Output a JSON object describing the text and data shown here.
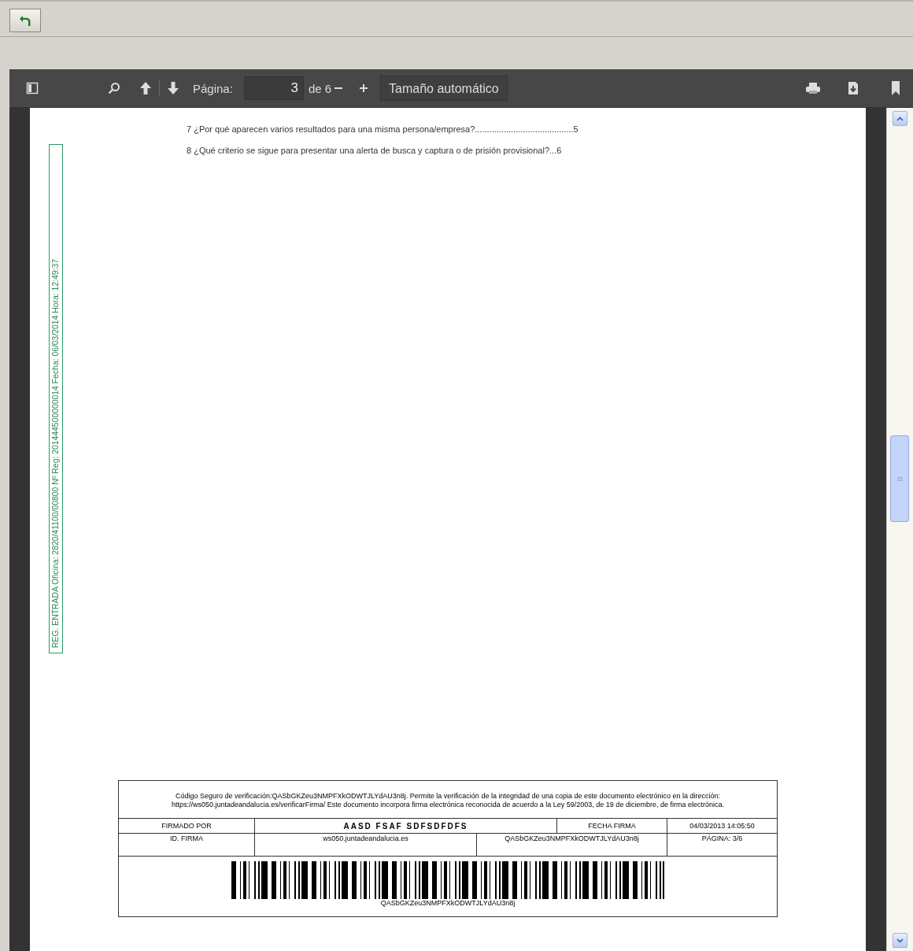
{
  "toolbar": {
    "page_label": "Página:",
    "page_number": "3",
    "page_count": "de 6",
    "zoom": "Tamaño automático"
  },
  "page": {
    "toc_lines": [
      {
        "text": "7 ¿Por qué aparecen varios resultados para una misma persona/empresa?.........................................5"
      },
      {
        "text": "8 ¿Qué criterio se sigue para presentar una alerta de busca y captura o de prisión provisional?...6"
      }
    ],
    "registry_stamp": "REG. ENTRADA Oficina: 2820/41100/00800 Nº Reg: 201444500000014 Fecha: 06/03/2014 Hora: 12:49:37",
    "signature_block": {
      "notice": "Código Seguro de verificación:QASbGKZeu3NMPFXkODWTJLYdAU3n8j. Permite la verificación de la integridad de una copia de este documento electrónico en la dirección: https://ws050.juntadeandalucia.es/verificarFirma/ Este documento incorpora firma electrónica reconocida de acuerdo a la Ley 59/2003, de 19 de diciembre, de firma electrónica.",
      "signed_by_label": "FIRMADO POR",
      "signed_by": "AASD FSAF SDFSDFDFS",
      "date_label": "FECHA FIRMA",
      "date": "04/03/2013 14:05:50",
      "id_label": "ID. FIRMA",
      "id_host": "ws050.juntadeandalucia.es",
      "id_code": "QASbGKZeu3NMPFXkODWTJLYdAU3n8j",
      "page_label": "PÁGINA: 3/6",
      "barcode_text": "QASbGKZeu3NMPFXkODWTJLYdAU3n8j"
    }
  }
}
